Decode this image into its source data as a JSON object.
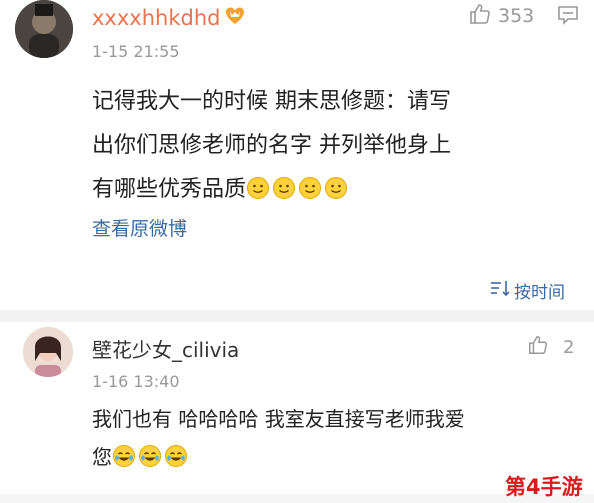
{
  "comment1": {
    "username": "xxxxhhkdhd",
    "like_count": "353",
    "timestamp": "1-15 21:55",
    "text_line1": "记得我大一的时候 期末思修题：请写",
    "text_line2": "出你们思修老师的名字 并列举他身上",
    "text_line3": "有哪些优秀品质",
    "emoji_count": 4,
    "view_original": "查看原微博"
  },
  "sort": {
    "label": "按时间"
  },
  "comment2": {
    "username": "壁花少女_cilivia",
    "like_count": "2",
    "timestamp": "1-16 13:40",
    "text_line1": "我们也有 哈哈哈哈 我室友直接写老师我爱",
    "text_line2": "您",
    "emoji_count": 3
  },
  "watermark": "第4手游",
  "colors": {
    "username_accent": "#eb7350",
    "link": "#3b6aa8",
    "watermark": "#d71c1c",
    "band": "#f2f2f2"
  }
}
